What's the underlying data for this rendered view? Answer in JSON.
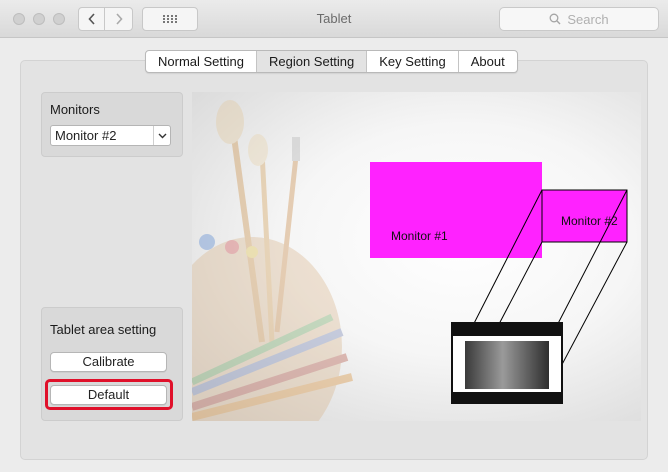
{
  "window": {
    "title": "Tablet",
    "search_placeholder": "Search"
  },
  "tabs": [
    {
      "label": "Normal Setting",
      "active": false
    },
    {
      "label": "Region Setting",
      "active": true
    },
    {
      "label": "Key Setting",
      "active": false
    },
    {
      "label": "About",
      "active": false
    }
  ],
  "monitors": {
    "title": "Monitors",
    "selected": "Monitor #2"
  },
  "tablet_area": {
    "title": "Tablet area setting",
    "calibrate_label": "Calibrate",
    "default_label": "Default"
  },
  "preview": {
    "monitor1_label": "Monitor #1",
    "monitor2_label": "Monitor #2",
    "monitor_color": "#ff22ff"
  },
  "colors": {
    "highlight": "#e0102a"
  }
}
